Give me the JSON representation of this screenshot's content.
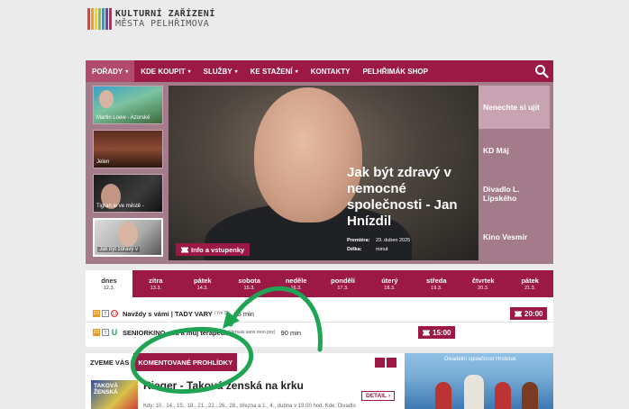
{
  "logo": {
    "line1": "KULTURNÍ ZAŘÍZENÍ",
    "line2": "MĚSTA PELHŘIMOVA",
    "colors": [
      "#e8412c",
      "#f3a019",
      "#f7d21f",
      "#8cc63e",
      "#2b9bd8",
      "#6a4a9c",
      "#c8246e"
    ]
  },
  "nav": {
    "items": [
      {
        "label": "POŘADY",
        "caret": "▾"
      },
      {
        "label": "KDE KOUPIT",
        "caret": "▾"
      },
      {
        "label": "SLUŽBY",
        "caret": "▾"
      },
      {
        "label": "KE STAŽENÍ",
        "caret": "▾"
      },
      {
        "label": "KONTAKTY",
        "caret": ""
      },
      {
        "label": "PELHŘIMÁK SHOP",
        "caret": ""
      }
    ],
    "search_icon": "search-icon"
  },
  "hero": {
    "thumbs": [
      {
        "caption": "Martin Loew - Azorské"
      },
      {
        "caption": "Jelen"
      },
      {
        "caption": "Tigran je ve městě -"
      },
      {
        "caption": "Jak být zdravý v"
      }
    ],
    "title": "Jak být zdravý v nemocné společnosti - Jan Hnízdil",
    "premiere_label": "Premiéra:",
    "premiere_value": "23. duben 2025",
    "length_label": "Délka:",
    "length_value": "minut",
    "button_label": "Info a vstupenky",
    "side": [
      "Nenechte si ujít",
      "KD Máj",
      "Divadlo L. Lipského",
      "Kino Vesmír"
    ]
  },
  "days": [
    {
      "name": "dnes",
      "date": "12.3."
    },
    {
      "name": "zítra",
      "date": "13.3."
    },
    {
      "name": "pátek",
      "date": "14.3."
    },
    {
      "name": "sobota",
      "date": "15.3."
    },
    {
      "name": "neděle",
      "date": "16.3."
    },
    {
      "name": "pondělí",
      "date": "17.3."
    },
    {
      "name": "úterý",
      "date": "18.3."
    },
    {
      "name": "středa",
      "date": "19.3."
    },
    {
      "name": "čtvrtek",
      "date": "20.3."
    },
    {
      "name": "pátek",
      "date": "21.3."
    }
  ],
  "events": [
    {
      "badges": [
        "2D",
        "T",
        "12"
      ],
      "title": "Navždy s vámi | TADY VARY",
      "sub": "( I'm St",
      "duration": "35 min",
      "time": "20:00"
    },
    {
      "badges": [
        "2D",
        "T",
        "U"
      ],
      "title": "SENIORKINO - Já a můj terapeut",
      "sub": "(Jersais sans reoo psy)",
      "duration": "90 min",
      "time": "15:00"
    }
  ],
  "bottom": {
    "tab1": "ZVEME VÁS",
    "tab2": "KOMENTOVANÉ PROHLÍDKY",
    "poster_text": "TAKOVÁ ŽENSKÁ",
    "title": "Rieger - Taková ženská na krku",
    "detail_label": "DETAIL",
    "text": "Kdy: 10., 14., 15., 18., 21., 22., 26., 28., března a 1., 4., dubna v 19:00 hod. Kde: Divadlo",
    "photo_caption": "Divadelní společnost Hrobouk"
  },
  "colors": {
    "brand": "#9c1946",
    "annotation": "#1fa454"
  }
}
